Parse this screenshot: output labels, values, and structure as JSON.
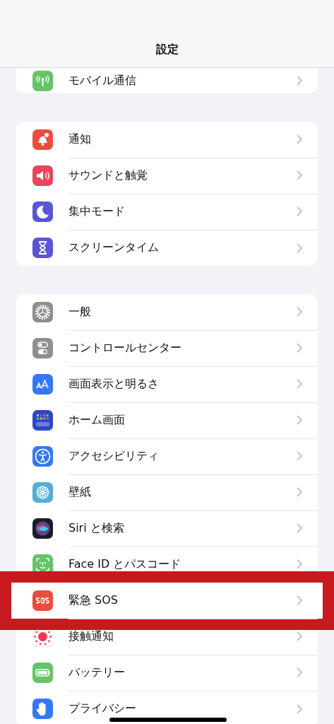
{
  "nav_bar": {
    "title": "設定"
  },
  "groups": [
    {
      "rows": [
        {
          "label": "モバイル通信",
          "kind": "cellular",
          "highlighted": false
        }
      ]
    },
    {
      "rows": [
        {
          "label": "通知",
          "kind": "bell",
          "highlighted": false
        },
        {
          "label": "サウンドと触覚",
          "kind": "speaker",
          "highlighted": false
        },
        {
          "label": "集中モード",
          "kind": "moon",
          "highlighted": false
        },
        {
          "label": "スクリーンタイム",
          "kind": "hourglass",
          "highlighted": false
        }
      ]
    },
    {
      "rows": [
        {
          "label": "一般",
          "kind": "gear",
          "highlighted": false
        },
        {
          "label": "コントロールセンター",
          "kind": "toggles",
          "highlighted": false
        },
        {
          "label": "画面表示と明るさ",
          "kind": "text-size",
          "highlighted": false
        },
        {
          "label": "ホーム画面",
          "kind": "grid",
          "highlighted": false
        },
        {
          "label": "アクセシビリティ",
          "kind": "person",
          "highlighted": false
        },
        {
          "label": "壁紙",
          "kind": "flower",
          "highlighted": false
        },
        {
          "label": "Siri と検索",
          "kind": "orb",
          "highlighted": false
        },
        {
          "label": "Face ID とパスコード",
          "kind": "face",
          "highlighted": false
        },
        {
          "label": "緊急 SOS",
          "kind": "sos",
          "highlighted": true
        },
        {
          "label": "接触通知",
          "kind": "dots",
          "highlighted": false
        },
        {
          "label": "バッテリー",
          "kind": "battery",
          "highlighted": false
        },
        {
          "label": "プライバシー",
          "kind": "hand",
          "highlighted": false
        }
      ]
    }
  ]
}
